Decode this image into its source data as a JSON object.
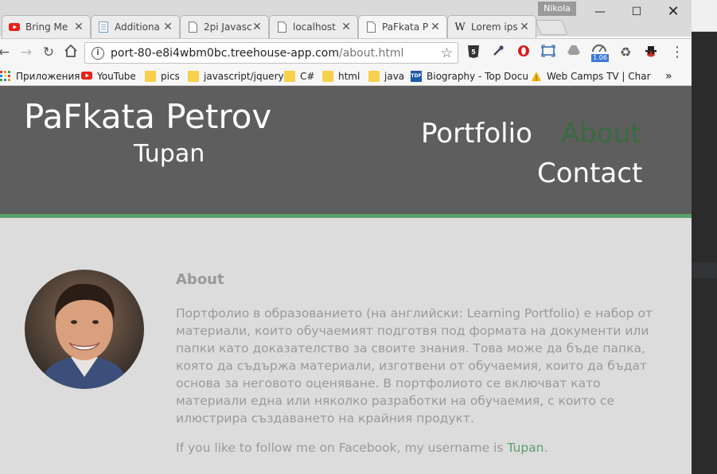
{
  "browser": {
    "tabs": [
      {
        "label": "Bring Me",
        "favicon": "youtube-icon"
      },
      {
        "label": "Additiona",
        "favicon": "document-icon"
      },
      {
        "label": "2pi Javasc",
        "favicon": "page-icon"
      },
      {
        "label": "localhost",
        "favicon": "page-icon"
      },
      {
        "label": "PaFkata P",
        "favicon": "page-icon",
        "active": true
      },
      {
        "label": "Lorem ips",
        "favicon": "wikipedia-icon"
      }
    ],
    "profile_name": "Nikola",
    "address": {
      "host": "port-80-e8i4wbm0bc.treehouse-app.com",
      "path": "/about.html"
    },
    "extension_badge": "1.06",
    "bookmarks": [
      {
        "label": "Приложения",
        "icon": "apps-grid-icon"
      },
      {
        "label": "YouTube",
        "icon": "youtube-icon"
      },
      {
        "label": "pics",
        "icon": "folder-icon"
      },
      {
        "label": "javascript/jquery",
        "icon": "folder-icon"
      },
      {
        "label": "C#",
        "icon": "folder-icon"
      },
      {
        "label": "html",
        "icon": "folder-icon"
      },
      {
        "label": "java",
        "icon": "folder-icon"
      },
      {
        "label": "Biography - Top Docu",
        "icon": "tdf-icon"
      },
      {
        "label": "Web Camps TV | Char",
        "icon": "webcamps-icon"
      }
    ],
    "bookmarks_overflow": "»"
  },
  "site": {
    "name": "PaFkata Petrov",
    "subtitle": "Tupan",
    "nav": {
      "portfolio": "Portfolio",
      "about": "About",
      "contact": "Contact"
    },
    "about_heading": "About",
    "about_text": "Портфолио в образованието (на английски: Learning Portfolio) е набор от материали, които обучаемият подготвя под формата на документи или папки като доказателство за своите знания. Това може да бъде папка, която да съдържа материали, изготвени от обучаемия, които да бъдат основа за неговото оценяване. В портфолиото се включват като материали една или няколко разработки на обучаемия, с които се илюстрира създаването на крайния продукт.",
    "follow_prefix": "If you like to follow me on Facebook, my username is ",
    "follow_link": "Tupan",
    "follow_suffix": "."
  },
  "colors": {
    "header_bg": "#5e5e5e",
    "accent_green": "#5aa06a",
    "selected_nav": "#3a6b3f",
    "page_bg": "#dcdcdc",
    "body_text": "#9a9a9a"
  }
}
